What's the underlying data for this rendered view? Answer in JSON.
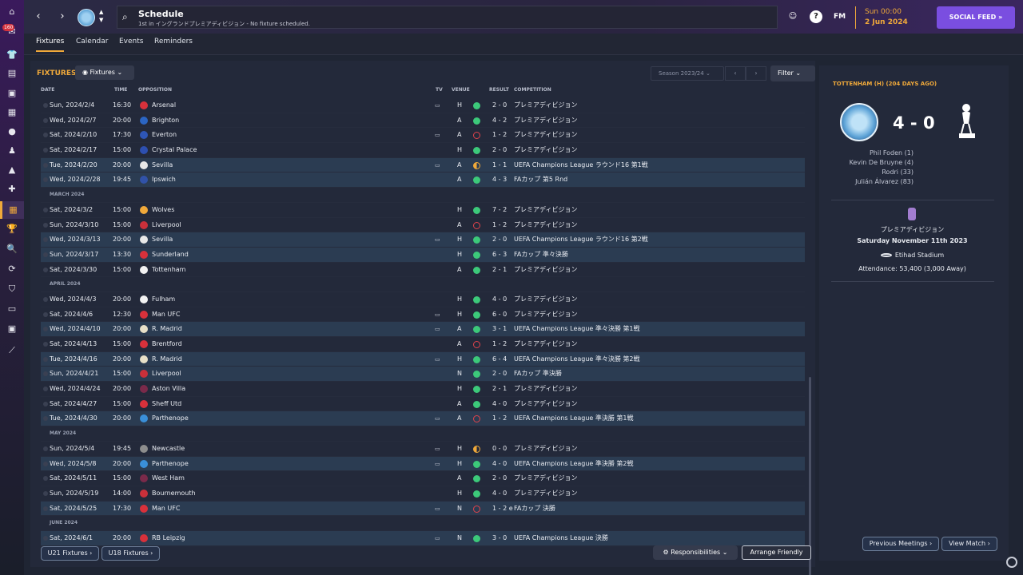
{
  "header": {
    "title": "Schedule",
    "subtitle": "1st in イングランドプレミアディビジョン - No fixture scheduled.",
    "fm_label": "FM",
    "date_time": "Sun 00:00",
    "date_date": "2 Jun 2024",
    "social_label": "SOCIAL FEED",
    "social_arrow": "»"
  },
  "rail": {
    "badge": "160"
  },
  "tabs": [
    "Fixtures",
    "Calendar",
    "Events",
    "Reminders"
  ],
  "fixtures": {
    "title": "FIXTURES",
    "dropdown_label": "Fixtures",
    "season_label": "Season 2023/24",
    "filter_label": "Filter",
    "columns": [
      "DATE",
      "TIME",
      "OPPOSITION",
      "TV",
      "VENUE",
      "RESULT",
      "COMPETITION"
    ]
  },
  "rows": [
    {
      "type": "match",
      "date": "Sun, 2024/2/4",
      "time": "16:30",
      "team": "Arsenal",
      "crest": "#d8313b",
      "tv": true,
      "venue": "H",
      "result": "win",
      "score": "2 - 0",
      "comp": "プレミアディビジョン",
      "cl": false
    },
    {
      "type": "match",
      "date": "Wed, 2024/2/7",
      "time": "20:00",
      "team": "Brighton",
      "crest": "#2b65c3",
      "tv": false,
      "venue": "A",
      "result": "win",
      "score": "4 - 2",
      "comp": "プレミアディビジョン",
      "cl": false
    },
    {
      "type": "match",
      "date": "Sat, 2024/2/10",
      "time": "17:30",
      "team": "Everton",
      "crest": "#2e56b7",
      "tv": true,
      "venue": "A",
      "result": "loss",
      "score": "1 - 2",
      "comp": "プレミアディビジョン",
      "cl": false
    },
    {
      "type": "match",
      "date": "Sat, 2024/2/17",
      "time": "15:00",
      "team": "Crystal Palace",
      "crest": "#2d4fb0",
      "tv": false,
      "venue": "H",
      "result": "win",
      "score": "2 - 0",
      "comp": "プレミアディビジョン",
      "cl": false
    },
    {
      "type": "match",
      "date": "Tue, 2024/2/20",
      "time": "20:00",
      "team": "Sevilla",
      "crest": "#e8e8e8",
      "tv": true,
      "venue": "A",
      "result": "draw",
      "score": "1 - 1",
      "comp": "UEFA Champions League ラウンド16 第1戦",
      "cl": true
    },
    {
      "type": "match",
      "date": "Wed, 2024/2/28",
      "time": "19:45",
      "team": "Ipswich",
      "crest": "#3152a8",
      "tv": false,
      "venue": "A",
      "result": "win",
      "score": "4 - 3",
      "comp": "FAカップ 第5 Rnd",
      "cl": true
    },
    {
      "type": "month",
      "label": "MARCH 2024"
    },
    {
      "type": "match",
      "date": "Sat, 2024/3/2",
      "time": "15:00",
      "team": "Wolves",
      "crest": "#f0a93a",
      "tv": false,
      "venue": "H",
      "result": "win",
      "score": "7 - 2",
      "comp": "プレミアディビジョン",
      "cl": false
    },
    {
      "type": "match",
      "date": "Sun, 2024/3/10",
      "time": "15:00",
      "team": "Liverpool",
      "crest": "#c9303a",
      "tv": false,
      "venue": "A",
      "result": "loss",
      "score": "1 - 2",
      "comp": "プレミアディビジョン",
      "cl": false
    },
    {
      "type": "match",
      "date": "Wed, 2024/3/13",
      "time": "20:00",
      "team": "Sevilla",
      "crest": "#e8e8e8",
      "tv": true,
      "venue": "H",
      "result": "win",
      "score": "2 - 0",
      "comp": "UEFA Champions League ラウンド16 第2戦",
      "cl": true
    },
    {
      "type": "match",
      "date": "Sun, 2024/3/17",
      "time": "13:30",
      "team": "Sunderland",
      "crest": "#d8313b",
      "tv": false,
      "venue": "H",
      "result": "win",
      "score": "6 - 3",
      "comp": "FAカップ 準々決勝",
      "cl": true
    },
    {
      "type": "match",
      "date": "Sat, 2024/3/30",
      "time": "15:00",
      "team": "Tottenham",
      "crest": "#f2f2f2",
      "tv": false,
      "venue": "A",
      "result": "win",
      "score": "2 - 1",
      "comp": "プレミアディビジョン",
      "cl": false
    },
    {
      "type": "month",
      "label": "APRIL 2024"
    },
    {
      "type": "match",
      "date": "Wed, 2024/4/3",
      "time": "20:00",
      "team": "Fulham",
      "crest": "#f2f2f2",
      "tv": false,
      "venue": "H",
      "result": "win",
      "score": "4 - 0",
      "comp": "プレミアディビジョン",
      "cl": false
    },
    {
      "type": "match",
      "date": "Sat, 2024/4/6",
      "time": "12:30",
      "team": "Man UFC",
      "crest": "#d8313b",
      "tv": true,
      "venue": "H",
      "result": "win",
      "score": "6 - 0",
      "comp": "プレミアディビジョン",
      "cl": false
    },
    {
      "type": "match",
      "date": "Wed, 2024/4/10",
      "time": "20:00",
      "team": "R. Madrid",
      "crest": "#e8e0c8",
      "tv": true,
      "venue": "A",
      "result": "win",
      "score": "3 - 1",
      "comp": "UEFA Champions League 準々決勝 第1戦",
      "cl": true
    },
    {
      "type": "match",
      "date": "Sat, 2024/4/13",
      "time": "15:00",
      "team": "Brentford",
      "crest": "#d8313b",
      "tv": false,
      "venue": "A",
      "result": "loss",
      "score": "1 - 2",
      "comp": "プレミアディビジョン",
      "cl": false
    },
    {
      "type": "match",
      "date": "Tue, 2024/4/16",
      "time": "20:00",
      "team": "R. Madrid",
      "crest": "#e8e0c8",
      "tv": true,
      "venue": "H",
      "result": "win",
      "score": "6 - 4",
      "comp": "UEFA Champions League 準々決勝 第2戦",
      "cl": true
    },
    {
      "type": "match",
      "date": "Sun, 2024/4/21",
      "time": "15:00",
      "team": "Liverpool",
      "crest": "#c9303a",
      "tv": false,
      "venue": "N",
      "result": "win",
      "score": "2 - 0",
      "comp": "FAカップ 準決勝",
      "cl": true
    },
    {
      "type": "match",
      "date": "Wed, 2024/4/24",
      "time": "20:00",
      "team": "Aston Villa",
      "crest": "#7a2a4a",
      "tv": false,
      "venue": "H",
      "result": "win",
      "score": "2 - 1",
      "comp": "プレミアディビジョン",
      "cl": false
    },
    {
      "type": "match",
      "date": "Sat, 2024/4/27",
      "time": "15:00",
      "team": "Sheff Utd",
      "crest": "#d8313b",
      "tv": false,
      "venue": "A",
      "result": "win",
      "score": "4 - 0",
      "comp": "プレミアディビジョン",
      "cl": false
    },
    {
      "type": "match",
      "date": "Tue, 2024/4/30",
      "time": "20:00",
      "team": "Parthenope",
      "crest": "#3a8fd8",
      "tv": true,
      "venue": "A",
      "result": "loss",
      "score": "1 - 2",
      "comp": "UEFA Champions League 準決勝 第1戦",
      "cl": true
    },
    {
      "type": "month",
      "label": "MAY 2024"
    },
    {
      "type": "match",
      "date": "Sun, 2024/5/4",
      "time": "19:45",
      "team": "Newcastle",
      "crest": "#8d8d8d",
      "tv": true,
      "venue": "H",
      "result": "draw",
      "score": "0 - 0",
      "comp": "プレミアディビジョン",
      "cl": false
    },
    {
      "type": "match",
      "date": "Wed, 2024/5/8",
      "time": "20:00",
      "team": "Parthenope",
      "crest": "#3a8fd8",
      "tv": true,
      "venue": "H",
      "result": "win",
      "score": "4 - 0",
      "comp": "UEFA Champions League 準決勝 第2戦",
      "cl": true
    },
    {
      "type": "match",
      "date": "Sat, 2024/5/11",
      "time": "15:00",
      "team": "West Ham",
      "crest": "#7a2a4a",
      "tv": false,
      "venue": "A",
      "result": "win",
      "score": "2 - 0",
      "comp": "プレミアディビジョン",
      "cl": false
    },
    {
      "type": "match",
      "date": "Sun, 2024/5/19",
      "time": "14:00",
      "team": "Bournemouth",
      "crest": "#c9303a",
      "tv": false,
      "venue": "H",
      "result": "win",
      "score": "4 - 0",
      "comp": "プレミアディビジョン",
      "cl": false
    },
    {
      "type": "match",
      "date": "Sat, 2024/5/25",
      "time": "17:30",
      "team": "Man UFC",
      "crest": "#d8313b",
      "tv": true,
      "venue": "N",
      "result": "loss",
      "score": "1 - 2 e",
      "comp": "FAカップ 決勝",
      "cl": true
    },
    {
      "type": "month",
      "label": "JUNE 2024"
    },
    {
      "type": "match",
      "date": "Sat, 2024/6/1",
      "time": "20:00",
      "team": "RB Leipzig",
      "crest": "#d8313b",
      "tv": true,
      "venue": "N",
      "result": "win",
      "score": "3 - 0",
      "comp": "UEFA Champions League 決勝",
      "cl": true
    }
  ],
  "footer": {
    "u21": "U21 Fixtures",
    "u18": "U18 Fixtures",
    "responsibilities": "Responsibilities",
    "arrange": "Arrange Friendly"
  },
  "side": {
    "title": "TOTTENHAM (H) (204 DAYS AGO)",
    "score": "4 - 0",
    "scorers": [
      "Phil Foden (1)",
      "Kevin De Bruyne (4)",
      "Rodri (33)",
      "Julián Álvarez (83)"
    ],
    "competition": "プレミアディビジョン",
    "date": "Saturday November 11th 2023",
    "stadium": "Etihad Stadium",
    "attendance": "Attendance: 53,400 (3,000 Away)",
    "prev_label": "Previous Meetings",
    "view_label": "View Match"
  },
  "colors": {
    "accent": "#f0a93a",
    "win": "#3cc97a",
    "loss": "#e0434c",
    "draw": "#f0a93a",
    "cl_row": "#2b3c52"
  }
}
